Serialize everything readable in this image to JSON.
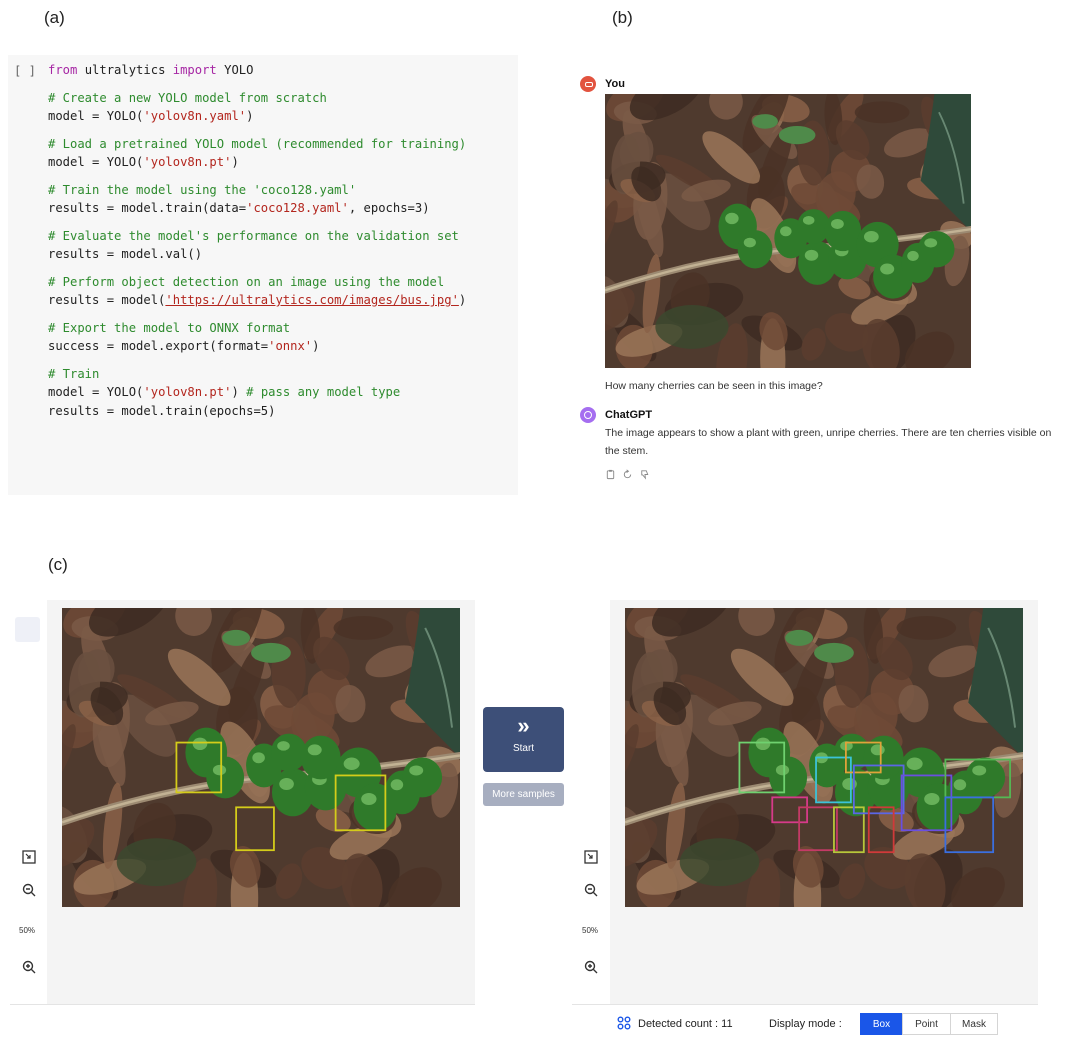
{
  "labels": {
    "a": "(a)",
    "b": "(b)",
    "c": "(c)"
  },
  "code": {
    "gutter": "[ ]",
    "lines": [
      [
        [
          "kw",
          "from"
        ],
        [
          "pl",
          " ultralytics "
        ],
        [
          "kw",
          "import"
        ],
        [
          "pl",
          " YOLO"
        ]
      ],
      [],
      [
        [
          "cm",
          "# Create a new YOLO model from scratch"
        ]
      ],
      [
        [
          "pl",
          "model = YOLO("
        ],
        [
          "st",
          "'yolov8n.yaml'"
        ],
        [
          "pl",
          ")"
        ]
      ],
      [],
      [
        [
          "cm",
          "# Load a pretrained YOLO model (recommended for training)"
        ]
      ],
      [
        [
          "pl",
          "model = YOLO("
        ],
        [
          "st",
          "'yolov8n.pt'"
        ],
        [
          "pl",
          ")"
        ]
      ],
      [],
      [
        [
          "cm",
          "# Train the model using the 'coco128.yaml'"
        ]
      ],
      [
        [
          "pl",
          "results = model.train(data="
        ],
        [
          "st",
          "'coco128.yaml'"
        ],
        [
          "pl",
          ", epochs=3)"
        ]
      ],
      [],
      [
        [
          "cm",
          "# Evaluate the model's performance on the validation set"
        ]
      ],
      [
        [
          "pl",
          "results = model.val()"
        ]
      ],
      [],
      [
        [
          "cm",
          "# Perform object detection on an image using the model"
        ]
      ],
      [
        [
          "pl",
          "results = model("
        ],
        [
          "lk",
          "'https://ultralytics.com/images/bus.jpg'"
        ],
        [
          "pl",
          ")"
        ]
      ],
      [],
      [
        [
          "cm",
          "# Export the model to ONNX format"
        ]
      ],
      [
        [
          "pl",
          "success = model.export(format="
        ],
        [
          "st",
          "'onnx'"
        ],
        [
          "pl",
          ")"
        ]
      ],
      [],
      [
        [
          "cm",
          "# Train"
        ]
      ],
      [
        [
          "pl",
          "model = YOLO("
        ],
        [
          "st",
          "'yolov8n.pt'"
        ],
        [
          "pl",
          ") "
        ],
        [
          "cm",
          "# pass any model type"
        ]
      ],
      [
        [
          "pl",
          "results = model.train(epochs=5)"
        ]
      ]
    ]
  },
  "chat": {
    "user_name": "You",
    "question": "How many cherries can be seen in this image?",
    "bot_name": "ChatGPT",
    "answer_line1": "The image appears to show a plant with green, unripe cherries. There are ten cherries visible on",
    "answer_line2": "the stem."
  },
  "viewer": {
    "zoom": "50%",
    "start_label": "Start",
    "start_icon": "»",
    "more_samples": "More samples",
    "detected_count_label": "Detected count :",
    "detected_count": "11",
    "display_mode_label": "Display mode :",
    "modes": [
      "Box",
      "Point",
      "Mask"
    ],
    "active_mode": "Box"
  },
  "colors": {
    "left_boxes": "#d4cc1a",
    "right_boxes": [
      "#6fd16f",
      "#d63a8a",
      "#c43a66",
      "#b7c73a",
      "#3bc3d9",
      "#e0a33a",
      "#5b66e6",
      "#6a4fe0",
      "#54b854",
      "#3a6fe0",
      "#d03a3a"
    ]
  }
}
